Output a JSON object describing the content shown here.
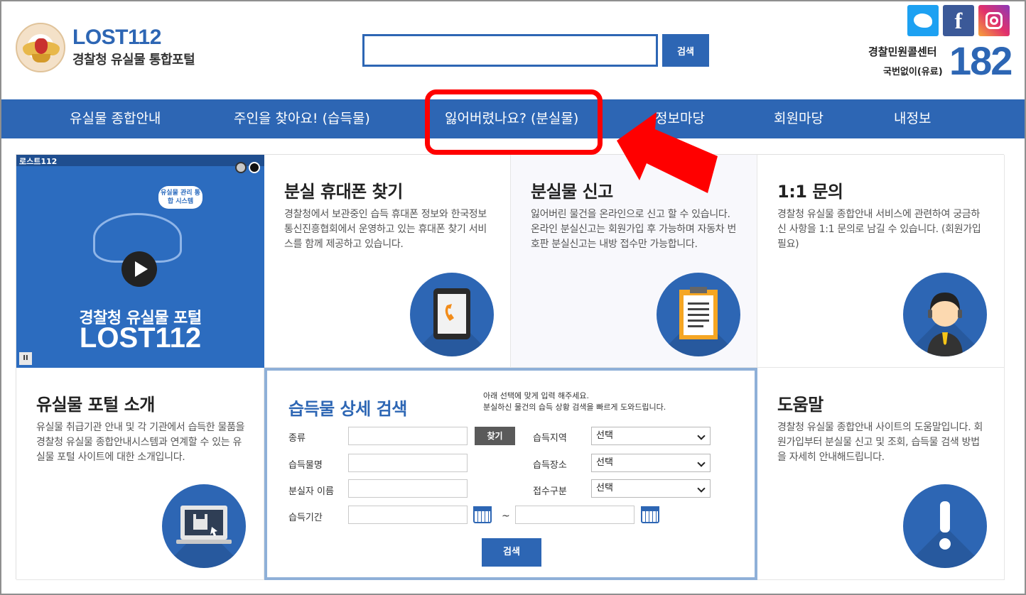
{
  "header": {
    "brand_name": "LOST112",
    "brand_sub": "경찰청 유실물 통합포털",
    "search_placeholder": "",
    "search_button": "검색",
    "social": [
      "twitter-icon",
      "facebook-icon",
      "instagram-icon"
    ],
    "call_center_label": "경찰민원콜센터",
    "call_center_sub": "국번없이(유료)",
    "call_center_number": "182"
  },
  "nav": {
    "items": [
      {
        "label": "유실물 종합안내"
      },
      {
        "label": "주인을 찾아요! (습득물)"
      },
      {
        "label": "잃어버렸나요? (분실물)"
      },
      {
        "label": "정보마당"
      },
      {
        "label": "회원마당"
      },
      {
        "label": "내정보"
      }
    ]
  },
  "video": {
    "label": "로스트112",
    "bubble": "유실물 관리 통합 시스템",
    "title": "경찰청 유실물 포털",
    "title2": "LOST112",
    "pause": "II"
  },
  "cards": {
    "phone": {
      "title": "분실 휴대폰 찾기",
      "desc": "경찰청에서 보관중인 습득 휴대폰 정보와 한국정보통신진흥협회에서 운영하고 있는 휴대폰 찾기 서비스를 함께 제공하고 있습니다."
    },
    "report": {
      "title": "분실물 신고",
      "desc": "잃어버린 물건을 온라인으로 신고 할 수 있습니다. 온라인 분실신고는 회원가입 후 가능하며 자동차 번호판 분실신고는 내방 접수만 가능합니다."
    },
    "inquiry": {
      "title": "1:1 문의",
      "desc": "경찰청 유실물 종합안내 서비스에 관련하여 궁금하신 사항을 1:1 문의로 남길 수 있습니다. (회원가입 필요)"
    },
    "intro": {
      "title": "유실물 포털 소개",
      "desc": "유실물 취급기관 안내 및 각 기관에서 습득한 물품을 경찰청 유실물 종합안내시스템과 연계할 수 있는 유실물 포털 사이트에 대한 소개입니다."
    },
    "help": {
      "title": "도움말",
      "desc": "경찰청 유실물 종합안내 사이트의 도움말입니다. 회원가입부터 분실물 신고 및 조회, 습득물 검색 방법을 자세히 안내해드립니다."
    }
  },
  "search_form": {
    "title": "습득물 상세 검색",
    "desc_line1": "아래 선택에 맞게 입력 해주세요.",
    "desc_line2": "분실하신 물건의 습득 상황 검색을 빠르게 도와드립니다.",
    "kind_label": "종류",
    "find_button": "찾기",
    "item_name_label": "습득물명",
    "loser_name_label": "분실자 이름",
    "period_label": "습득기간",
    "tilde": "~",
    "region_label": "습득지역",
    "place_label": "습득장소",
    "receipt_label": "접수구분",
    "select_default": "선택",
    "submit_button": "검색"
  },
  "colors": {
    "brand_blue": "#2d66b4",
    "annotation_red": "#ff0000"
  }
}
